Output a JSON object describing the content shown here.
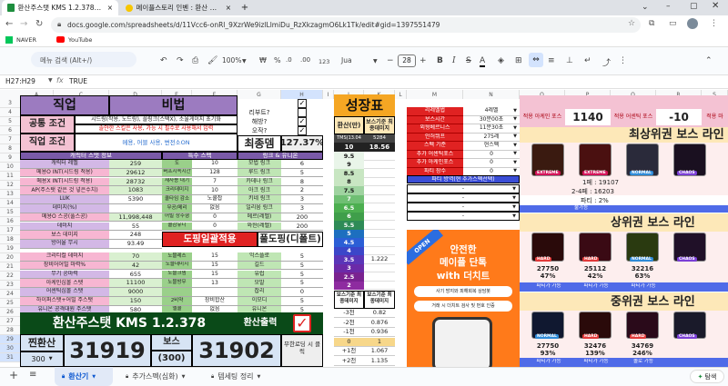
{
  "browser": {
    "tabs": [
      {
        "title": "환산주스탯 KMS 1.2.378의 사본"
      },
      {
        "title": "메이플스토리 인벤 : 환산 주스탯"
      }
    ],
    "url": "docs.google.com/spreadsheets/d/11Vcc6-onRl_9XzrWe9izlLlmiDu_RzXkzagmO6Lk1Tk/edit#gid=1397551479",
    "bookmarks": [
      "NAVER",
      "YouTube"
    ]
  },
  "toolbar": {
    "menu_search": "메뉴 검색 (Alt+/)",
    "zoom": "100%",
    "currency": "₩",
    "percent": "%",
    "decimals_dec": ".0",
    "decimals_inc": ".00",
    "format_num": "123",
    "font": "Jua",
    "font_size": "28"
  },
  "formula": {
    "cellref": "H27:H29",
    "fx": "fx",
    "value": "TRUE"
  },
  "columns": [
    "A",
    "B",
    "C",
    "D",
    "E",
    "F",
    "G",
    "H",
    "I",
    "J",
    "K",
    "L",
    "M",
    "N",
    "O",
    "P",
    "Q",
    "R",
    "S"
  ],
  "rows": [
    "3",
    "4",
    "5",
    "6",
    "7",
    "8",
    "9",
    "10",
    "11",
    "12",
    "13",
    "14",
    "15",
    "16",
    "17",
    "18",
    "19",
    "20",
    "21",
    "22",
    "23",
    "24",
    "25",
    "26",
    "27",
    "28",
    "29",
    "30",
    "31",
    "32",
    "33"
  ],
  "left": {
    "title_a": "직업",
    "title_b": "비법",
    "gongtong": "공통 조건",
    "jikeop": "직업 조건",
    "line1": "시드링(작용, 노드링), 플링크(스택X), 소울게이지 초기화",
    "line2": "솔얀한 스킬은 사용, 가능 시 필수로 사용해서 입력",
    "line3": "메용, 어블 사용, 변전소ON",
    "ribot": "리부트?",
    "haebang": "해방?",
    "ohjak": "오작?",
    "final_dmg": "최종뎀",
    "final_pct": "127.37%",
    "hdr_char": "캐릭터 스탯 정보",
    "hdr_special": "특수 스펙",
    "hdr_link": "링크 & 유니온",
    "stats": [
      {
        "label": "캐릭터 레벨",
        "value": "259",
        "sp": "도",
        "spv": "10",
        "lk": "모법 링크",
        "lkv": "6"
      },
      {
        "label": "메용O INT(시드링 적용)",
        "value": "29612",
        "sp": "버프지속시간",
        "spv": "128",
        "lk": "루드 링크",
        "lkv": "5"
      },
      {
        "label": "메용X INT(시드링 적용)",
        "value": "28732",
        "sp": "재사용 대기",
        "spv": "7",
        "lk": "카데나 링크",
        "lkv": "8"
      },
      {
        "label": "AP(주스탯 같은 것 넣은수치)",
        "value": "1083",
        "sp": "크리데미지",
        "spv": "10",
        "lk": "아크 링크",
        "lkv": "2"
      },
      {
        "label": "LUK",
        "value": "5390",
        "sp": "쿨타임 감소",
        "spv": "노쿨잡",
        "lk": "키네 링크",
        "lkv": "3"
      },
      {
        "label": "데미지(%)",
        "value": "",
        "sp": "무공/메리",
        "spv": "없음",
        "lk": "일리움 링크",
        "lkv": "3"
      },
      {
        "label": "메용O 스공(풀스공)",
        "value": "11,998,448",
        "sp": "어빌 상주형",
        "spv": "0",
        "lk": "메르(레벨)",
        "lkv": "200"
      },
      {
        "label": "데미지",
        "value": "55",
        "sp": "쿨감유니",
        "spv": "0",
        "lk": "와헌(레벨)",
        "lkv": "200"
      },
      {
        "label": "보스 데미지",
        "value": "248",
        "sp": "",
        "spv": "",
        "lk": "",
        "lkv": ""
      },
      {
        "label": "방어율 무시",
        "value": "93.49",
        "sp": "",
        "spv": "",
        "lk": "",
        "lkv": ""
      },
      {
        "label": "크리티컬 데미지",
        "value": "70",
        "sp": "노블레스",
        "spv": "15",
        "lk": "익스플로",
        "lkv": "5"
      },
      {
        "label": "장비어어빌 마력%",
        "value": "42",
        "sp": "노블데미지",
        "spv": "15",
        "lk": "길드",
        "lkv": "5"
      },
      {
        "label": "무기 공마력",
        "value": "655",
        "sp": "노블크뎀",
        "spv": "15",
        "lk": "유럽",
        "lkv": "5"
      },
      {
        "label": "아케인심볼 스탯",
        "value": "11100",
        "sp": "노블방무",
        "spv": "13",
        "lk": "모발",
        "lkv": "5"
      },
      {
        "label": "어센틱심볼 스탯",
        "value": "9000",
        "sp": "",
        "spv": "",
        "lk": "잡리",
        "lkv": "0"
      },
      {
        "label": "하이퍼스탯+어빌 주스탯",
        "value": "150",
        "sp": "2비약",
        "spv": "장비합산",
        "lk": "이모디",
        "lkv": "5"
      },
      {
        "label": "유니온 공격대원 주스탯",
        "value": "580",
        "sp": "엘쿨",
        "spv": "없음",
        "lk": "유니온",
        "lkv": "5"
      }
    ],
    "banner1": "도핑일괄적용",
    "banner2": "풀도핑(디폴트)",
    "bottom_title": "환산주스탯 KMS 1.2.378",
    "bottom_btn": "환산출력",
    "lbl_real": "찐환산",
    "val_300": "300",
    "boss_lbl": "보스",
    "boss_300": "(300)",
    "total1": "31919",
    "total2": "31902",
    "nocool": "무한로딩 시 클릭"
  },
  "mid": {
    "title": "성장표",
    "col1": "환산(만)",
    "col2": "보스기준 최종데미지",
    "tms": "TMS(13.04",
    "tms2": "5284",
    "tms_b": "10",
    "tms_b2": "18.56",
    "levels": [
      "9.5",
      "9",
      "8.5",
      "8",
      "7.5",
      "7",
      "6.5",
      "6",
      "5.5",
      "5",
      "4.5",
      "4",
      "3.5",
      "3",
      "2.5",
      "2"
    ],
    "lvl_vals": [
      "",
      "",
      "",
      "",
      "",
      "",
      "",
      "",
      "",
      "",
      "",
      "",
      "1.222",
      "",
      "",
      ""
    ],
    "bot_hdr1": "보스기준 최종데미지",
    "bot_rows": [
      {
        "k": "-3천",
        "v": "0.82"
      },
      {
        "k": "-2천",
        "v": "0.876"
      },
      {
        "k": "-1천",
        "v": "0.936"
      },
      {
        "k": "0",
        "v": "1"
      },
      {
        "k": "+1천",
        "v": "1.067"
      },
      {
        "k": "+2천",
        "v": "1.135"
      }
    ]
  },
  "right": {
    "settings": [
      {
        "k": "리레벨법",
        "v": "4레벨"
      },
      {
        "k": "보스시간",
        "v": "30분00초"
      },
      {
        "k": "외형베르니스",
        "v": "11분30초"
      },
      {
        "k": "인허뷔프",
        "v": "275레"
      },
      {
        "k": "스펙 기준",
        "v": "현스펙"
      },
      {
        "k": "추가 어센틱포스",
        "v": "0"
      },
      {
        "k": "추가 아케인포스",
        "v": "0"
      },
      {
        "k": "파티 장수",
        "v": "0"
      }
    ],
    "party_hdr": "파티 방역(현 추가스펙선택)",
    "arcane_lbl": "적용 아케인 포스",
    "arcane_val": "1140",
    "asc_lbl": "적용 어센틱 포스",
    "asc_val": "-10",
    "ajin_lbl": "적용 마",
    "header_top": "캐릭터 정보 ... 최신 보스",
    "sec1": "최상위권 보스 라인",
    "sec1_info1": "1페 : 19107",
    "sec1_info2": "2-4페 : 16203",
    "sec1_info3": "파티 : 2%",
    "sec1_note": "불가능",
    "sec2": "상위권 보스 라인",
    "sec2_vals": [
      "27750",
      "25112",
      "32216"
    ],
    "sec2_pcts": [
      "47%",
      "42%",
      "63%"
    ],
    "sec2_status": [
      "파티가 가능",
      "파티가 가능",
      "파티가 가능"
    ],
    "sec3": "중위권 보스 라인",
    "sec3_vals": [
      "27750",
      "32476",
      "34769"
    ],
    "sec3_pcts": [
      "93%",
      "139%",
      "246%"
    ],
    "sec3_status": [
      "파티가 가능",
      "파티가 가능",
      "솔로 가능"
    ],
    "boss_tags": [
      "EXTREME",
      "EXTREME",
      "NORMAL",
      "CHAOS",
      "HARD",
      "HARD",
      "NORMAL",
      "CHAOS",
      "NORMAL",
      "HARD",
      "HARD",
      "CHAOS"
    ]
  },
  "ad": {
    "open": "OPEN",
    "line1": "안전한",
    "line2": "메이플 단톡",
    "line3": "with 더치트",
    "sub1": "사기 방지와 피해회복 상담봇",
    "sub2": "거래 시 더치트 검사 및 번호 인증"
  },
  "sheets": [
    {
      "name": "환산기"
    },
    {
      "name": "추가스펙(심화)"
    },
    {
      "name": "템세팅 정리"
    }
  ],
  "explore": "탐색",
  "colors": {
    "purple": "#8d6bb1",
    "blue_hdr": "#5b6fd6",
    "green": "#2e8b57",
    "red": "#e02222",
    "darkgreen": "#0a4a18"
  }
}
